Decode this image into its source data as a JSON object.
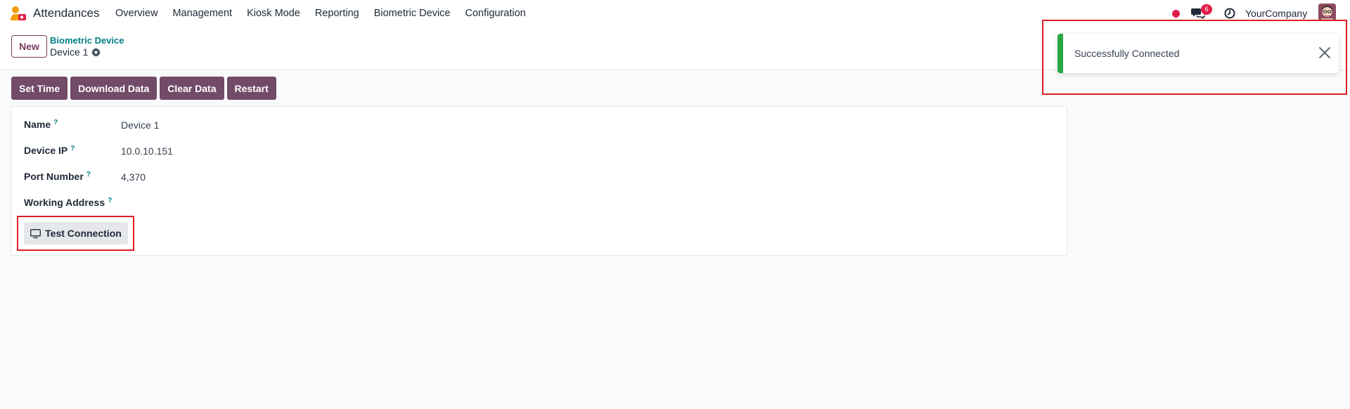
{
  "app": {
    "name": "Attendances"
  },
  "nav": {
    "items": [
      {
        "label": "Overview"
      },
      {
        "label": "Management"
      },
      {
        "label": "Kiosk Mode"
      },
      {
        "label": "Reporting"
      },
      {
        "label": "Biometric Device"
      },
      {
        "label": "Configuration"
      }
    ]
  },
  "systray": {
    "chat_count": "6",
    "company": "YourCompany"
  },
  "control": {
    "new_label": "New",
    "breadcrumb_parent": "Biometric Device",
    "record_title": "Device 1"
  },
  "actions": [
    {
      "label": "Set Time"
    },
    {
      "label": "Download Data"
    },
    {
      "label": "Clear Data"
    },
    {
      "label": "Restart"
    }
  ],
  "form": {
    "fields": [
      {
        "label": "Name",
        "help": "?",
        "value": "Device 1"
      },
      {
        "label": "Device IP",
        "help": "?",
        "value": "10.0.10.151"
      },
      {
        "label": "Port Number",
        "help": "?",
        "value": "4,370"
      },
      {
        "label": "Working Address",
        "help": "?",
        "value": ""
      }
    ],
    "test_button_label": "Test Connection"
  },
  "toast": {
    "message": "Successfully Connected"
  },
  "colors": {
    "primary": "#714b67",
    "link": "#017e84",
    "success": "#28a745",
    "highlight": "#e11d24"
  }
}
